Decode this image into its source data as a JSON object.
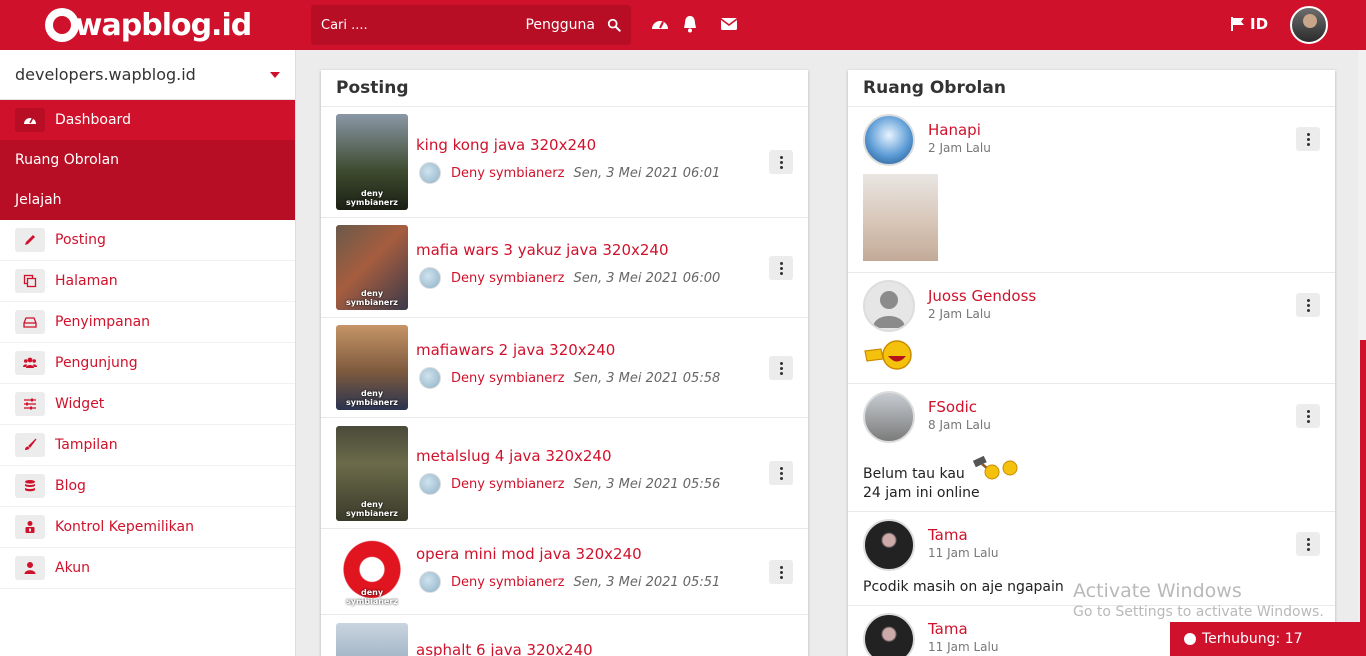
{
  "header": {
    "logo": "wapblog.id",
    "search_placeholder": "Cari ....",
    "search_type": "Pengguna",
    "language": "ID"
  },
  "sidebar": {
    "site": "developers.wapblog.id",
    "active": "Dashboard",
    "sub_items": [
      "Ruang Obrolan",
      "Jelajah"
    ],
    "items": [
      "Posting",
      "Halaman",
      "Penyimpanan",
      "Pengunjung",
      "Widget",
      "Tampilan",
      "Blog",
      "Kontrol Kepemilikan",
      "Akun"
    ]
  },
  "posts": {
    "title": "Posting",
    "thumb_label": "deny symbianerz",
    "items": [
      {
        "title": "king kong java 320x240",
        "author": "Deny symbianerz",
        "date": "Sen, 3 Mei 2021 06:01"
      },
      {
        "title": "mafia wars 3 yakuz java 320x240",
        "author": "Deny symbianerz",
        "date": "Sen, 3 Mei 2021 06:00"
      },
      {
        "title": "mafiawars 2 java 320x240",
        "author": "Deny symbianerz",
        "date": "Sen, 3 Mei 2021 05:58"
      },
      {
        "title": "metalslug 4 java 320x240",
        "author": "Deny symbianerz",
        "date": "Sen, 3 Mei 2021 05:56"
      },
      {
        "title": "opera mini mod java 320x240",
        "author": "Deny symbianerz",
        "date": "Sen, 3 Mei 2021 05:51"
      },
      {
        "title": "asphalt 6 java 320x240",
        "author": "",
        "date": ""
      }
    ]
  },
  "chat": {
    "title": "Ruang Obrolan",
    "messages": [
      {
        "name": "Hanapi",
        "time": "2 Jam Lalu",
        "text": ""
      },
      {
        "name": "Juoss Gendoss",
        "time": "2 Jam Lalu",
        "text": ""
      },
      {
        "name": "FSodic",
        "time": "8 Jam Lalu",
        "text": "Belum tau kau",
        "text2": "24 jam ini online"
      },
      {
        "name": "Tama",
        "time": "11 Jam Lalu",
        "text": "Pcodik masih on aje ngapain"
      },
      {
        "name": "Tama",
        "time": "11 Jam Lalu",
        "text": ""
      }
    ]
  },
  "watermark": {
    "line1": "Activate Windows",
    "line2": "Go to Settings to activate Windows."
  },
  "online": "Terhubung: 17"
}
